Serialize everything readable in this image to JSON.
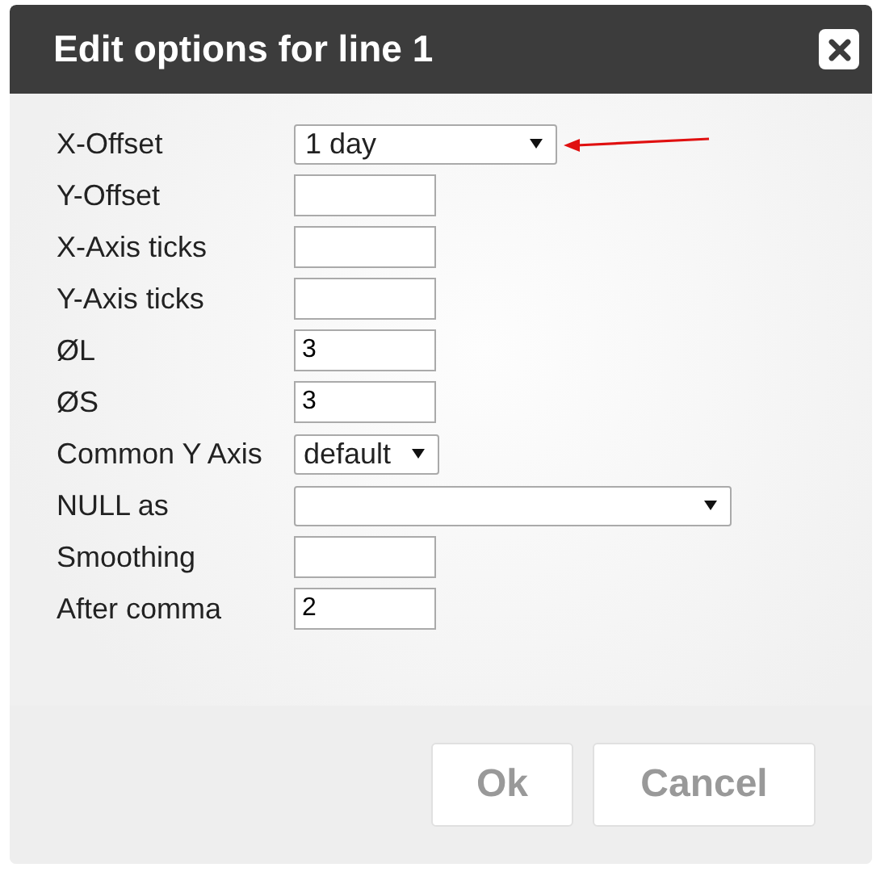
{
  "dialog": {
    "title": "Edit options for line 1"
  },
  "fields": [
    {
      "label": "X-Offset",
      "kind": "select",
      "value": "1 day"
    },
    {
      "label": "Y-Offset",
      "kind": "text"
    },
    {
      "label": "X-Axis ticks",
      "kind": "text"
    },
    {
      "label": "Y-Axis ticks",
      "kind": "text"
    },
    {
      "label": "ØL",
      "kind": "text",
      "value": "3"
    },
    {
      "label": "ØS",
      "kind": "text",
      "value": "3"
    },
    {
      "label": "Common Y Axis",
      "kind": "compact-select",
      "value": "default"
    },
    {
      "label": "NULL as",
      "kind": "wide-select"
    },
    {
      "label": "Smoothing",
      "kind": "text"
    },
    {
      "label": "After comma",
      "kind": "text",
      "value": "2"
    }
  ],
  "buttons": [
    {
      "label": "Ok"
    },
    {
      "label": "Cancel"
    }
  ]
}
